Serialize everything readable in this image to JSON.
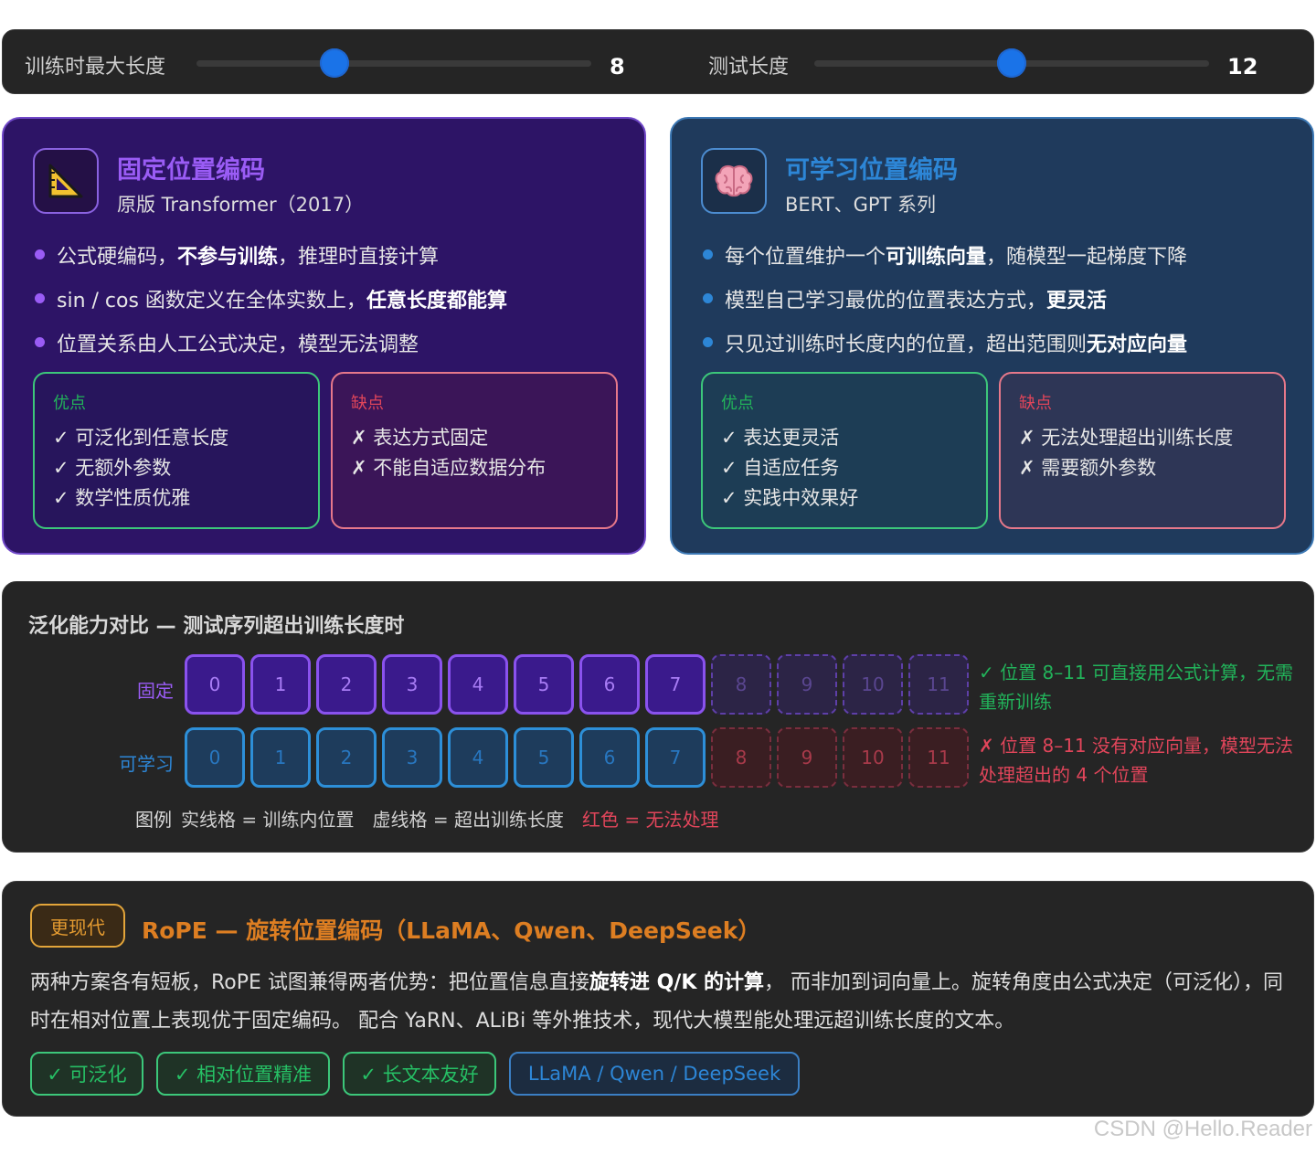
{
  "sliders": {
    "train": {
      "label": "训练时最大长度",
      "value": "8",
      "fraction": 0.35
    },
    "test": {
      "label": "测试长度",
      "value": "12",
      "fraction": 0.5
    }
  },
  "fixed_card": {
    "icon": "triangle-ruler-icon",
    "title": "固定位置编码",
    "subtitle": "原版 Transformer（2017）",
    "bullets": [
      {
        "pre": "公式硬编码，",
        "bold": "不参与训练",
        "post": "，推理时直接计算"
      },
      {
        "pre": "sin / cos 函数定义在全体实数上，",
        "bold": "任意长度都能算",
        "post": ""
      },
      {
        "pre": "位置关系由人工公式决定，模型无法调整",
        "bold": "",
        "post": ""
      }
    ],
    "pros": {
      "head": "优点",
      "items": [
        "✓ 可泛化到任意长度",
        "✓ 无额外参数",
        "✓ 数学性质优雅"
      ]
    },
    "cons": {
      "head": "缺点",
      "items": [
        "✗ 表达方式固定",
        "✗ 不能自适应数据分布"
      ]
    }
  },
  "learn_card": {
    "icon": "brain-icon",
    "title": "可学习位置编码",
    "subtitle": "BERT、GPT 系列",
    "bullets": [
      {
        "pre": "每个位置维护一个",
        "bold": "可训练向量",
        "post": "，随模型一起梯度下降"
      },
      {
        "pre": "模型自己学习最优的位置表达方式，",
        "bold": "更灵活",
        "post": ""
      },
      {
        "pre": "只见过训练时长度内的位置，超出范围则",
        "bold": "无对应向量",
        "post": ""
      }
    ],
    "pros": {
      "head": "优点",
      "items": [
        "✓ 表达更灵活",
        "✓ 自适应任务",
        "✓ 实践中效果好"
      ]
    },
    "cons": {
      "head": "缺点",
      "items": [
        "✗ 无法处理超出训练长度",
        "✗ 需要额外参数"
      ]
    }
  },
  "compare": {
    "title": "泛化能力对比 — 测试序列超出训练长度时",
    "fixed_label": "固定",
    "learn_label": "可学习",
    "positions": [
      "0",
      "1",
      "2",
      "3",
      "4",
      "5",
      "6",
      "7",
      "8",
      "9",
      "10",
      "11"
    ],
    "train_length": 8,
    "fixed_note": "✓ 位置 8–11 可直接用公式计算，无需重新训练",
    "learn_note": "✗ 位置 8–11 没有对应向量，模型无法处理超出的 4 个位置",
    "legend": {
      "head": "图例",
      "solid": "实线格 = 训练内位置",
      "dashed": "虚线格 = 超出训练长度",
      "red": "红色 = 无法处理"
    }
  },
  "rope": {
    "badge": "更现代",
    "title": "RoPE — 旋转位置编码（LLaMA、Qwen、DeepSeek）",
    "body_pre": "两种方案各有短板，RoPE 试图兼得两者优势：把位置信息直接",
    "body_bold": "旋转进 Q/K 的计算",
    "body_post": "， 而非加到词向量上。旋转角度由公式决定（可泛化），同时在相对位置上表现优于固定编码。 配合 YaRN、ALiBi 等外推技术，现代大模型能处理远超训练长度的文本。",
    "tags": [
      "✓ 可泛化",
      "✓ 相对位置精准",
      "✓ 长文本友好",
      "LLaMA / Qwen / DeepSeek"
    ]
  },
  "watermark": "CSDN @Hello.Reader",
  "colors": {
    "fixed_accent": "#9a5cf5",
    "learn_accent": "#2d86d6",
    "pro_green": "#22b35a",
    "con_red": "#e0455a",
    "rope_orange": "#dd7e22",
    "slider_blue": "#1a73e8"
  }
}
